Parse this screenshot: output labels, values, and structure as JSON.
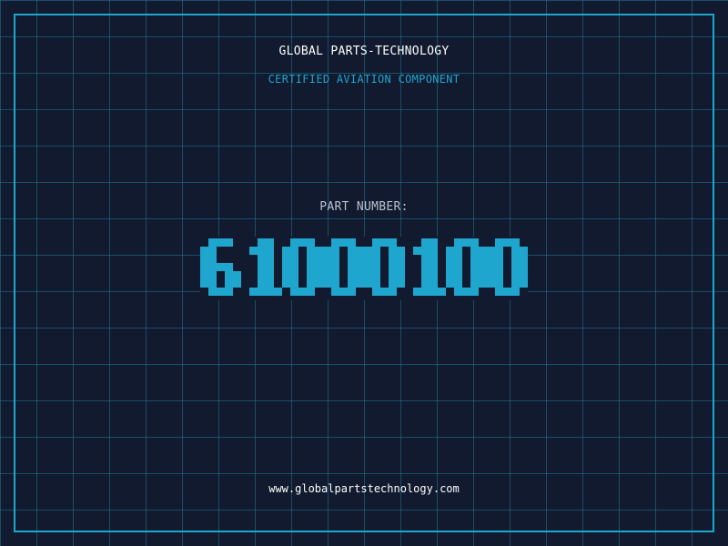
{
  "brand": {
    "company": "GLOBAL PARTS-TECHNOLOGY",
    "subtitle": "CERTIFIED AVIATION COMPONENT"
  },
  "part": {
    "label": "PART NUMBER:",
    "number": "61000100"
  },
  "footer": {
    "url": "www.globalpartstechnology.com"
  },
  "colors": {
    "background": "#111a2e",
    "grid": "#2178a0",
    "accent": "#1fa6cf",
    "text": "#ffffff",
    "muted": "#b9c2cf"
  }
}
